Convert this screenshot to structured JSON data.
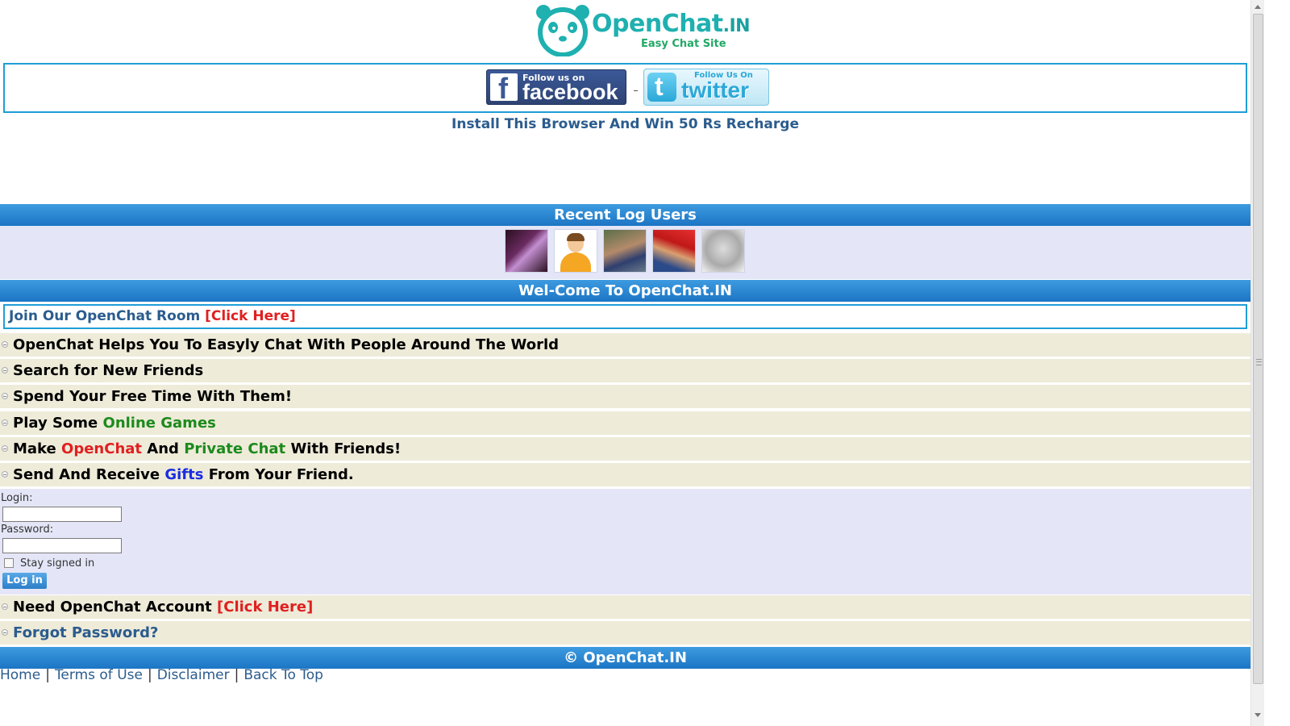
{
  "logo": {
    "name": "OpenChat",
    "tld": ".IN",
    "tagline": "Easy Chat Site",
    "icon": "panda-face-icon"
  },
  "social": {
    "facebook_top": "Follow us on",
    "facebook_name": "facebook",
    "twitter_top": "Follow Us On",
    "twitter_name": "twitter"
  },
  "promo": "Install This Browser And Win 50 Rs Recharge",
  "recent_users": {
    "title": "Recent Log Users",
    "count": 5
  },
  "welcome": "Wel-Come To OpenChat.IN",
  "join": {
    "text": "Join Our OpenChat Room ",
    "link": "[Click Here]"
  },
  "features": [
    {
      "parts": [
        {
          "t": "OpenChat Helps You To Easyly Chat With People Around The World"
        }
      ]
    },
    {
      "parts": [
        {
          "t": "Search for New Friends"
        }
      ]
    },
    {
      "parts": [
        {
          "t": "Spend Your Free Time With Them!"
        }
      ]
    },
    {
      "parts": [
        {
          "t": "Play Some "
        },
        {
          "t": "Online Games"
        }
      ]
    },
    {
      "parts": [
        {
          "t": "Make "
        },
        {
          "t": "OpenChat"
        },
        {
          "t": " And "
        },
        {
          "t": "Private Chat"
        },
        {
          "t": " With Friends!"
        }
      ]
    },
    {
      "parts": [
        {
          "t": "Send And Receive "
        },
        {
          "t": "Gifts"
        },
        {
          "t": " From Your Friend."
        }
      ]
    }
  ],
  "login": {
    "login_label": "Login:",
    "login_value": "",
    "password_label": "Password:",
    "password_value": "",
    "stay_signed_in": "Stay signed in",
    "stay_checked": false,
    "button": "Log in"
  },
  "account": {
    "text": "Need OpenChat Account ",
    "link": "[Click Here]"
  },
  "forgot": "Forgot Password?",
  "footer": {
    "copyright": "© OpenChat.IN",
    "links": [
      "Home",
      "Terms of Use",
      "Disclaimer",
      "Back To Top"
    ]
  },
  "colors": {
    "accent_blue": "#1c75c4",
    "link_navy": "#2b5c8e",
    "highlight_red": "#e02020",
    "highlight_green": "#1c8a1c",
    "highlight_blue": "#1a2ee0",
    "row_bg": "#eeebd9",
    "panel_bg": "#e4e6f7"
  }
}
